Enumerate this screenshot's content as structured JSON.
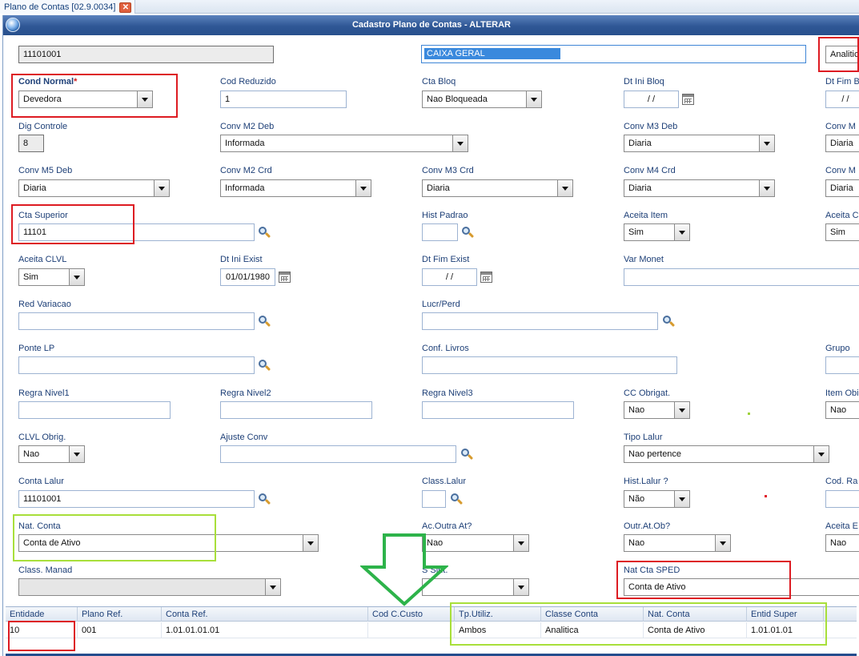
{
  "tab": {
    "title": "Plano de Contas [02.9.0034]",
    "close": "✕"
  },
  "window": {
    "title": "Cadastro Plano de Contas - ALTERAR"
  },
  "header": {
    "code": "11101001",
    "description": "CAIXA GERAL",
    "class_type": "Analitic"
  },
  "fields": {
    "cond_normal": {
      "label": "Cond Normal",
      "required_mark": "*",
      "value": "Devedora"
    },
    "cod_reduzido": {
      "label": "Cod Reduzido",
      "value": "1"
    },
    "cta_bloq": {
      "label": "Cta Bloq",
      "value": "Nao Bloqueada"
    },
    "dt_ini_bloq": {
      "label": "Dt Ini Bloq",
      "value": "/ /"
    },
    "dt_fim_bloq": {
      "label": "Dt Fim B",
      "value": "/ /"
    },
    "dig_controle": {
      "label": "Dig Controle",
      "value": "8"
    },
    "conv_m2_deb": {
      "label": "Conv M2 Deb",
      "value": "Informada"
    },
    "conv_m3_deb": {
      "label": "Conv M3 Deb",
      "value": "Diaria"
    },
    "conv_m4_deb": {
      "label": "Conv M",
      "value": "Diaria"
    },
    "conv_m5_deb": {
      "label": "Conv M5 Deb",
      "value": "Diaria"
    },
    "conv_m2_crd": {
      "label": "Conv M2 Crd",
      "value": "Informada"
    },
    "conv_m3_crd": {
      "label": "Conv M3 Crd",
      "value": "Diaria"
    },
    "conv_m4_crd": {
      "label": "Conv M4 Crd",
      "value": "Diaria"
    },
    "conv_m5_crd": {
      "label": "Conv M",
      "value": "Diaria"
    },
    "cta_superior": {
      "label": "Cta Superior",
      "value": "11101"
    },
    "hist_padrao": {
      "label": "Hist Padrao",
      "value": ""
    },
    "aceita_item": {
      "label": "Aceita Item",
      "value": "Sim"
    },
    "aceita_c": {
      "label": "Aceita C",
      "value": "Sim"
    },
    "aceita_clvl": {
      "label": "Aceita CLVL",
      "value": "Sim"
    },
    "dt_ini_exist": {
      "label": "Dt Ini Exist",
      "value": "01/01/1980"
    },
    "dt_fim_exist": {
      "label": "Dt Fim Exist",
      "value": "/ /"
    },
    "var_monet": {
      "label": "Var Monet",
      "value": ""
    },
    "red_variacao": {
      "label": "Red Variacao",
      "value": ""
    },
    "lucr_perd": {
      "label": "Lucr/Perd",
      "value": ""
    },
    "ponte_lp": {
      "label": "Ponte LP",
      "value": ""
    },
    "conf_livros": {
      "label": "Conf. Livros",
      "value": ""
    },
    "grupo": {
      "label": "Grupo",
      "value": ""
    },
    "regra_nivel1": {
      "label": "Regra Nivel1",
      "value": ""
    },
    "regra_nivel2": {
      "label": "Regra Nivel2",
      "value": ""
    },
    "regra_nivel3": {
      "label": "Regra Nivel3",
      "value": ""
    },
    "cc_obrigat": {
      "label": "CC Obrigat.",
      "value": "Nao"
    },
    "item_obrig": {
      "label": "Item Obi",
      "value": "Nao"
    },
    "clvl_obrig": {
      "label": "CLVL Obrig.",
      "value": "Nao"
    },
    "ajuste_conv": {
      "label": "Ajuste Conv",
      "value": ""
    },
    "tipo_lalur": {
      "label": "Tipo Lalur",
      "value": "Nao pertence"
    },
    "conta_lalur": {
      "label": "Conta Lalur",
      "value": "11101001"
    },
    "class_lalur": {
      "label": "Class.Lalur",
      "value": ""
    },
    "hist_lalur": {
      "label": "Hist.Lalur ?",
      "value": "Não"
    },
    "cod_ra": {
      "label": "Cod. Ra",
      "value": ""
    },
    "nat_conta": {
      "label": "Nat. Conta",
      "value": "Conta de Ativo"
    },
    "ac_outra_at": {
      "label": "Ac.Outra At?",
      "value": "Nao"
    },
    "outr_at_ob": {
      "label": "Outr.At.Ob?",
      "value": "Nao"
    },
    "aceita_e": {
      "label": "Aceita E",
      "value": "Nao"
    },
    "class_manad": {
      "label": "Class. Manad",
      "value": ""
    },
    "sped_sint": {
      "label": "S      Sint.",
      "value": ""
    },
    "nat_cta_sped": {
      "label": "Nat Cta SPED",
      "value": "Conta de Ativo"
    }
  },
  "grid": {
    "headers": [
      "Entidade",
      "Plano Ref.",
      "Conta Ref.",
      "Cod C.Custo",
      "Tp.Utiliz.",
      "Classe Conta",
      "Nat. Conta",
      "Entid Super"
    ],
    "row": [
      "10",
      "001",
      "1.01.01.01.01",
      "",
      "Ambos",
      "Analitica",
      "Conta de Ativo",
      "1.01.01.01"
    ]
  },
  "annotations": {
    "arrow_color": "#2db34a",
    "red_box_color": "#dd1b22",
    "green_box_color": "#a8df3a"
  }
}
